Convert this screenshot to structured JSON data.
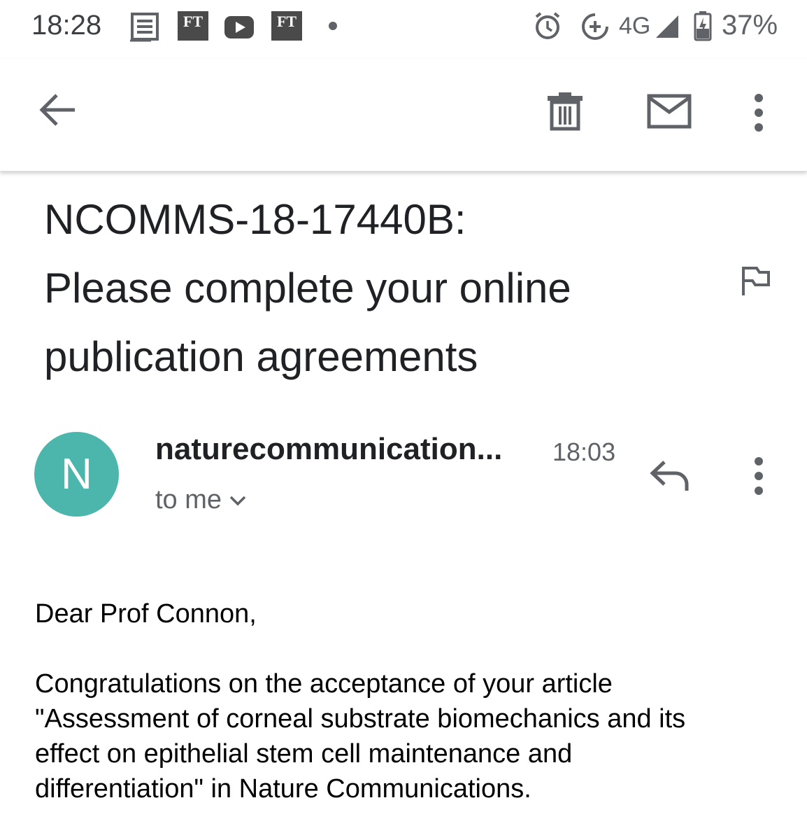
{
  "status_bar": {
    "time": "18:28",
    "notification_icons": [
      "newspaper-icon",
      "ft-app-icon",
      "youtube-icon",
      "ft-app-icon",
      "more-notifications-dot"
    ],
    "ft_label": "FT",
    "network": "4G",
    "battery": "37%",
    "system_icons": [
      "alarm-icon",
      "data-saver-icon",
      "signal-icon",
      "battery-charging-icon"
    ]
  },
  "toolbar": {
    "icons": [
      "back-arrow-icon",
      "delete-icon",
      "mark-unread-icon",
      "more-vert-icon"
    ]
  },
  "email": {
    "subject_lines": [
      "NCOMMS-18-17440B:",
      "Please complete your online",
      "publication agreements"
    ],
    "sender_initial": "N",
    "sender": "naturecommunication...",
    "time": "18:03",
    "recipient": "to me",
    "body": {
      "greeting": "Dear Prof Connon,",
      "paragraph_lines": [
        "Congratulations on the acceptance of your article",
        "\"Assessment of corneal substrate biomechanics and its",
        "effect on epithelial stem cell maintenance and",
        "differentiation\" in Nature Communications."
      ]
    }
  },
  "colors": {
    "avatar": "#4db6ac",
    "text_primary": "#202124",
    "text_secondary": "#5f6368",
    "icon": "#5f6368"
  }
}
